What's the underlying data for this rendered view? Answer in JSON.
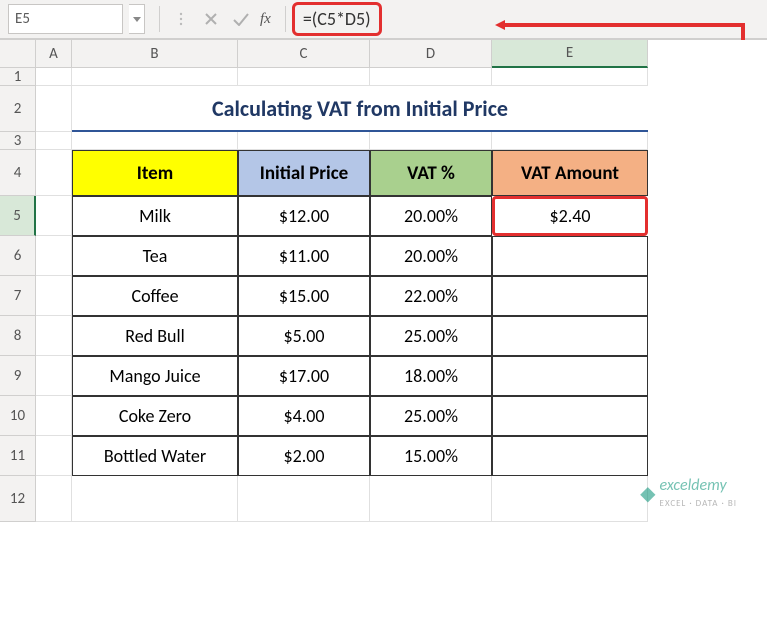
{
  "formulaBar": {
    "nameBox": "E5",
    "fx": "fx",
    "formula": "=(C5*D5)"
  },
  "columns": [
    "A",
    "B",
    "C",
    "D",
    "E"
  ],
  "rows": [
    "1",
    "2",
    "3",
    "4",
    "5",
    "6",
    "7",
    "8",
    "9",
    "10",
    "11",
    "12"
  ],
  "title": "Calculating VAT from Initial Price",
  "headers": {
    "item": "Item",
    "price": "Initial Price",
    "vat": "VAT %",
    "amount": "VAT Amount"
  },
  "data": [
    {
      "item": "Milk",
      "price": "$12.00",
      "vat": "20.00%",
      "amount": "$2.40"
    },
    {
      "item": "Tea",
      "price": "$11.00",
      "vat": "20.00%",
      "amount": ""
    },
    {
      "item": "Coffee",
      "price": "$15.00",
      "vat": "22.00%",
      "amount": ""
    },
    {
      "item": "Red Bull",
      "price": "$5.00",
      "vat": "25.00%",
      "amount": ""
    },
    {
      "item": "Mango Juice",
      "price": "$17.00",
      "vat": "18.00%",
      "amount": ""
    },
    {
      "item": "Coke Zero",
      "price": "$4.00",
      "vat": "25.00%",
      "amount": ""
    },
    {
      "item": "Bottled Water",
      "price": "$2.00",
      "vat": "15.00%",
      "amount": ""
    }
  ],
  "watermark": {
    "brand": "exceldemy",
    "tag": "EXCEL · DATA · BI"
  },
  "chart_data": {
    "type": "table",
    "title": "Calculating VAT from Initial Price",
    "columns": [
      "Item",
      "Initial Price",
      "VAT %",
      "VAT Amount"
    ],
    "rows": [
      [
        "Milk",
        12.0,
        0.2,
        2.4
      ],
      [
        "Tea",
        11.0,
        0.2,
        null
      ],
      [
        "Coffee",
        15.0,
        0.22,
        null
      ],
      [
        "Red Bull",
        5.0,
        0.25,
        null
      ],
      [
        "Mango Juice",
        17.0,
        0.18,
        null
      ],
      [
        "Coke Zero",
        4.0,
        0.25,
        null
      ],
      [
        "Bottled Water",
        2.0,
        0.15,
        null
      ]
    ],
    "active_cell": "E5",
    "formula": "=(C5*D5)"
  }
}
